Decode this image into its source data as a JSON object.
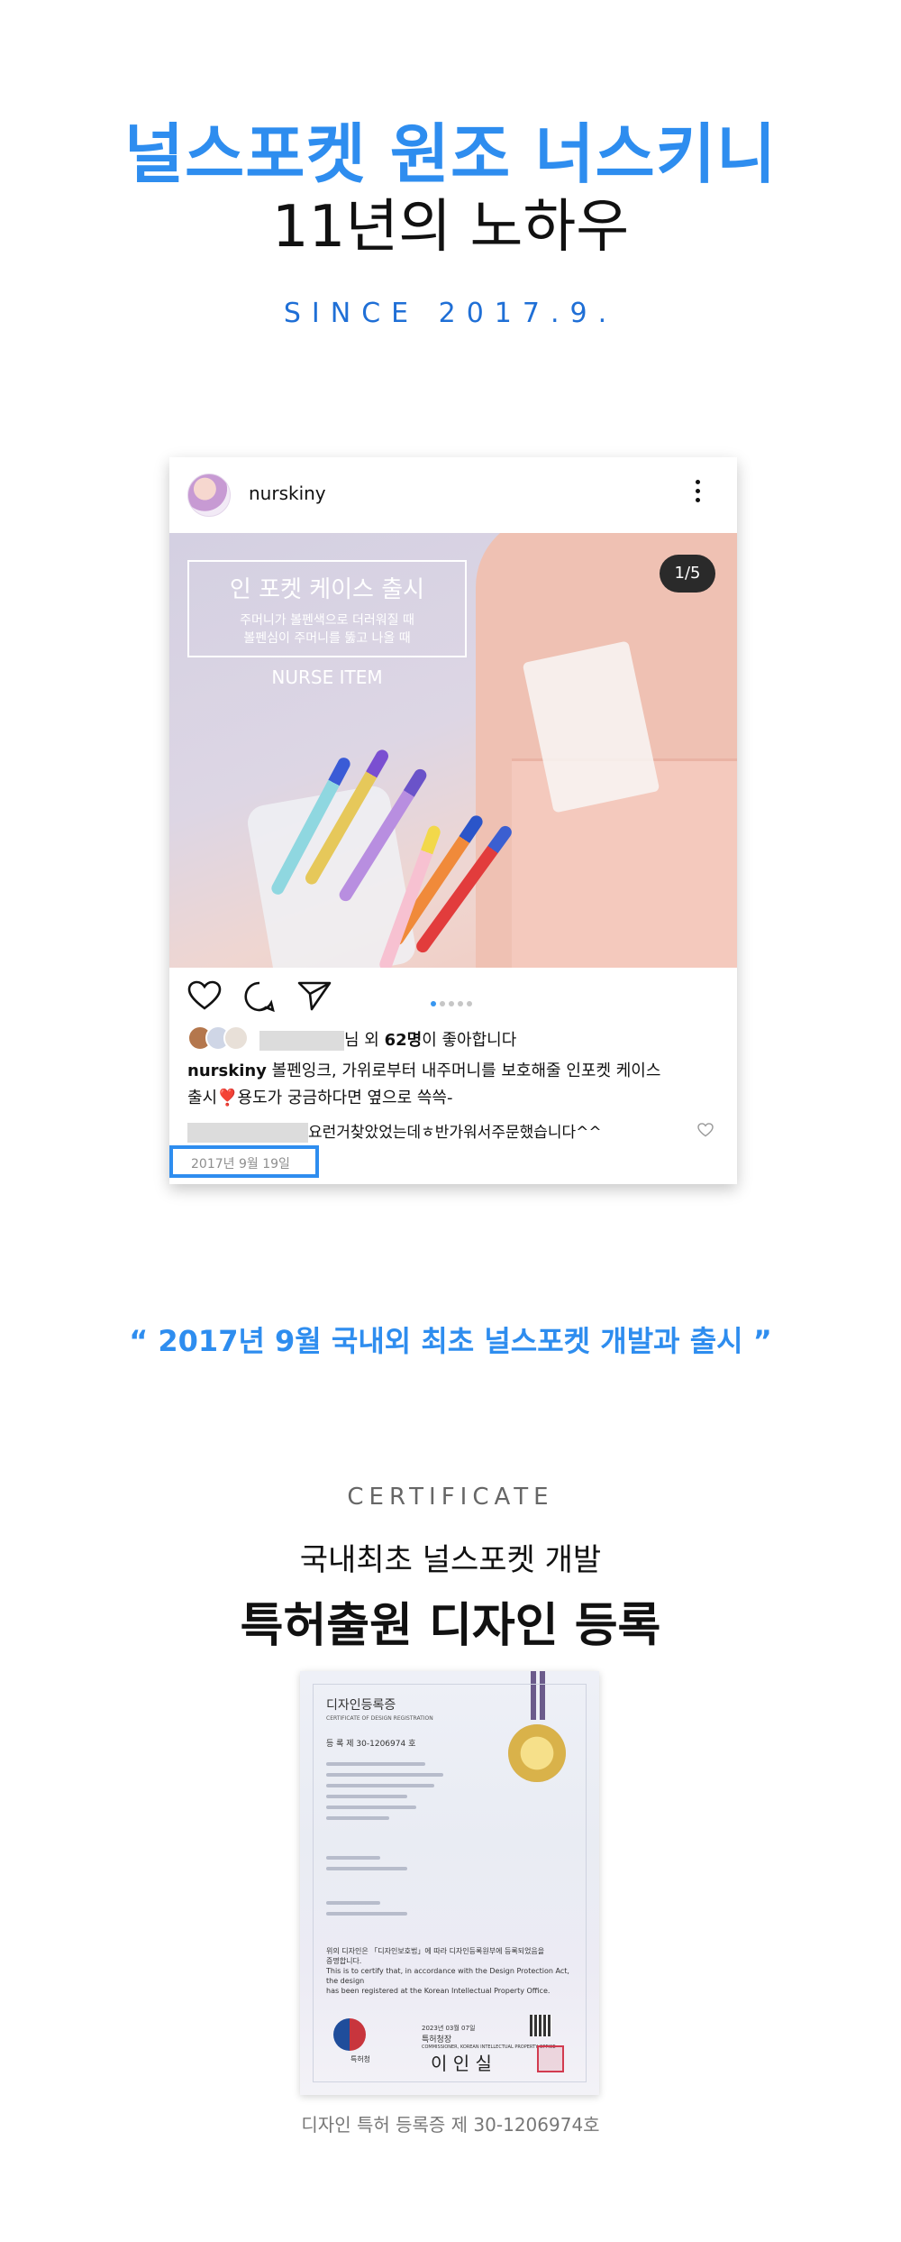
{
  "header": {
    "title": "널스포켓 원조 너스키니",
    "subtitle": "11년의 노하우",
    "since": "SINCE 2017.9."
  },
  "post": {
    "username": "nurskiny",
    "counter": "1/5",
    "promo": {
      "title": "인 포켓 케이스 출시",
      "line1": "주머니가 볼펜색으로 더러워질 때",
      "line2": "볼펜심이 주머니를 뚫고 나올 때",
      "tag": "NURSE ITEM"
    },
    "likes": {
      "suffix_pre": "님 외 ",
      "count": "62명",
      "suffix_post": "이 좋아합니다"
    },
    "caption": {
      "user": "nurskiny",
      "text1": " 볼펜잉크, 가위로부터 내주머니를 보호해줄 인포켓 케이스",
      "text2a": "출시",
      "emoji": "❣️",
      "text2b": "용도가 궁금하다면 옆으로 쓱쓱-"
    },
    "comment": "요런거찾았었는데ㅎ반가워서주문했습니다^^",
    "date": "2017년 9월 19일",
    "colors": {
      "accent": "#2e8def",
      "dot_active": "#3897f0"
    },
    "icons": [
      "heart-icon",
      "comment-icon",
      "share-icon",
      "more-icon"
    ]
  },
  "quote": "“ 2017년 9월 국내외 최초 널스포켓 개발과 출시 ”",
  "certificate": {
    "label": "CERTIFICATE",
    "subtitle": "국내최초 널스포켓 개발",
    "title": "특허출원 디자인 등록",
    "doc": {
      "heading": "디자인등록증",
      "heading_en": "CERTIFICATE OF DESIGN REGISTRATION",
      "reg": "등  록    제 30-1206974 호",
      "body1": "위의 디자인은 「디자인보호법」에 따라 디자인등록원부에 등록되었음을",
      "body2": "증명합니다.",
      "body3": "This is to certify that, in accordance with the Design Protection Act, the design",
      "body4": "has been registered at the Korean Intellectual Property Office.",
      "date": "2023년 03월 07일",
      "commissioner": "특허청장",
      "commissioner_en": "COMMISSIONER, KOREAN INTELLECTUAL PROPERTY OFFICE",
      "sign": "이 인 실",
      "office": "특허청"
    },
    "caption": "디자인 특허 등록증 제 30-1206974호"
  }
}
